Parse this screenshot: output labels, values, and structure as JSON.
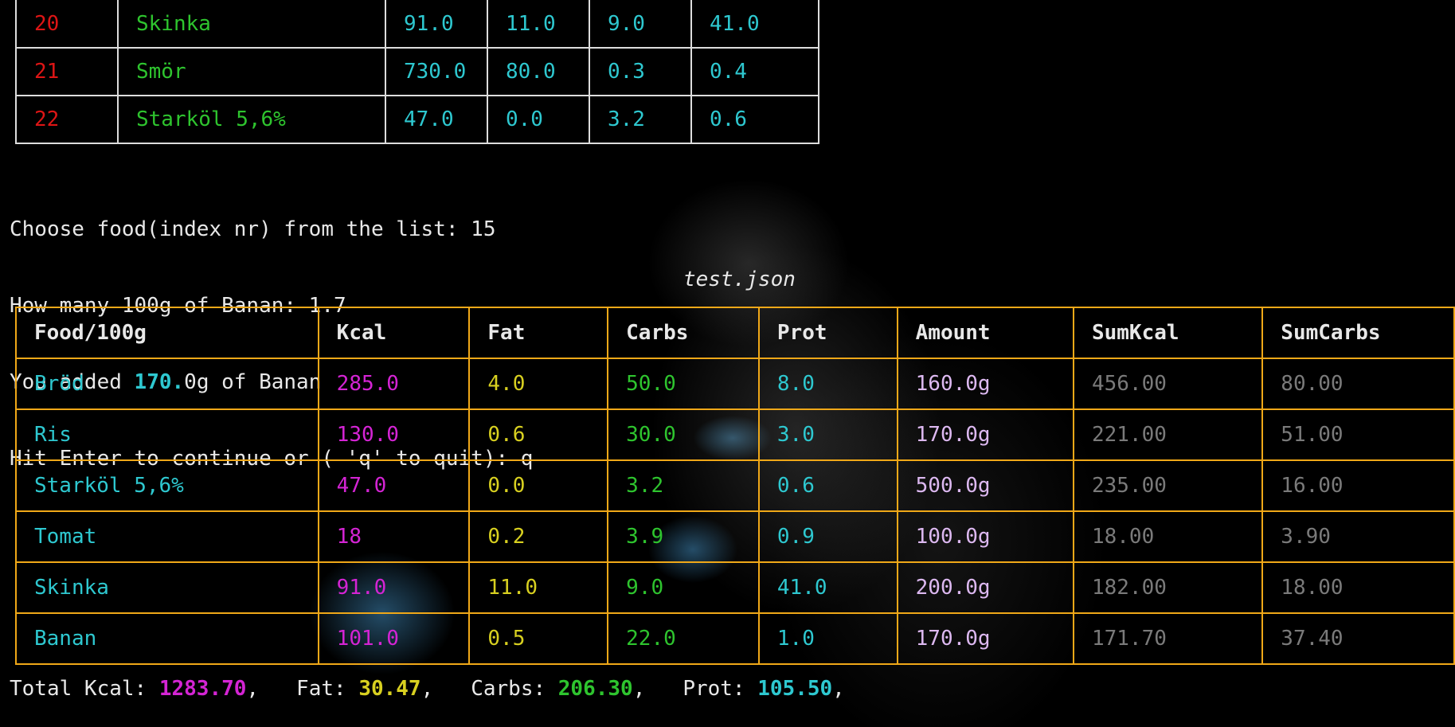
{
  "top_table": {
    "rows": [
      {
        "index": "20",
        "name": "Skinka",
        "kcal": "91.0",
        "fat": "11.0",
        "carbs": "9.0",
        "prot": "41.0"
      },
      {
        "index": "21",
        "name": "Smör",
        "kcal": "730.0",
        "fat": "80.0",
        "carbs": "0.3",
        "prot": "0.4"
      },
      {
        "index": "22",
        "name": "Starköl 5,6%",
        "kcal": "47.0",
        "fat": "0.0",
        "carbs": "3.2",
        "prot": "0.6"
      }
    ]
  },
  "prompt": {
    "line1": "Choose food(index nr) from the list: 15",
    "line2": "How many 100g of Banan: 1.7",
    "line3_pre": "You added ",
    "line3_hl": "170.",
    "line3_post": "0g of Banan",
    "line4": "Hit Enter to continue or ( 'q' to quit): q"
  },
  "caption": "test.json",
  "main_table": {
    "headers": [
      "Food/100g",
      "Kcal",
      "Fat",
      "Carbs",
      "Prot",
      "Amount",
      "SumKcal",
      "SumCarbs"
    ],
    "rows": [
      [
        "Bröd",
        "285.0",
        "4.0",
        "50.0",
        "8.0",
        "160.0g",
        "456.00",
        "80.00"
      ],
      [
        "Ris",
        "130.0",
        "0.6",
        "30.0",
        "3.0",
        "170.0g",
        "221.00",
        "51.00"
      ],
      [
        "Starköl 5,6%",
        "47.0",
        "0.0",
        "3.2",
        "0.6",
        "500.0g",
        "235.00",
        "16.00"
      ],
      [
        "Tomat",
        "18",
        "0.2",
        "3.9",
        "0.9",
        "100.0g",
        "18.00",
        "3.90"
      ],
      [
        "Skinka",
        "91.0",
        "11.0",
        "9.0",
        "41.0",
        "200.0g",
        "182.00",
        "18.00"
      ],
      [
        "Banan",
        "101.0",
        "0.5",
        "22.0",
        "1.0",
        "170.0g",
        "171.70",
        "37.40"
      ]
    ]
  },
  "totals": {
    "kcal_label": "Total Kcal: ",
    "kcal": "1283.70",
    "fat_label": ",   Fat: ",
    "fat": "30.47",
    "carbs_label": ",   Carbs: ",
    "carbs": "206.30",
    "prot_label": ",   Prot: ",
    "prot": "105.50",
    "trail": ","
  },
  "colors": {
    "table_border": "#f0a818",
    "index": "#dd1515",
    "food_name": "#2ec8d0",
    "kcal": "#d424d4",
    "fat": "#d8d020",
    "carbs": "#2ec42e",
    "prot": "#2ec8d0",
    "amount": "#dcb8f0",
    "sums": "#7a7a7a"
  }
}
